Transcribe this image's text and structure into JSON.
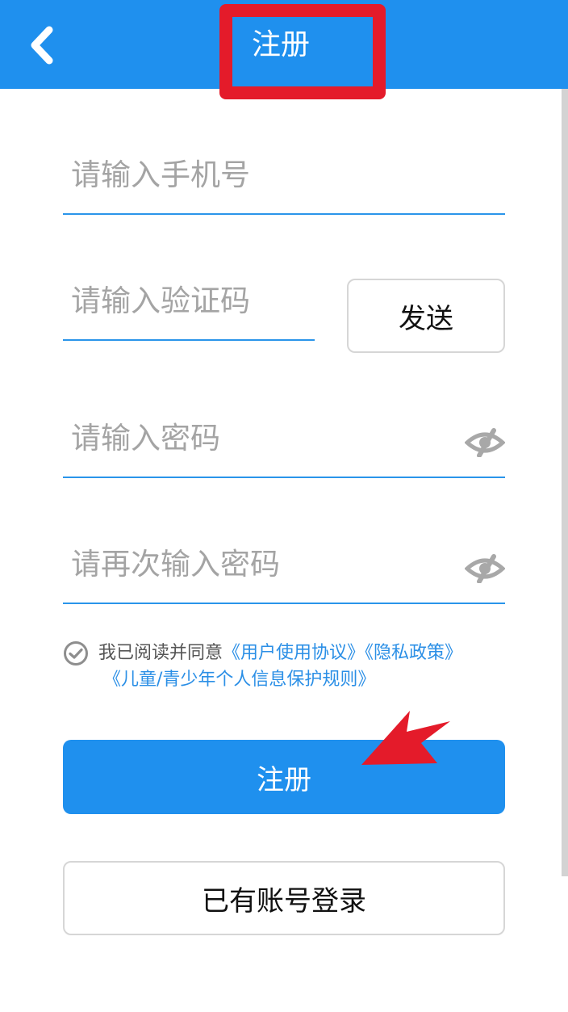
{
  "header": {
    "title": "注册",
    "back_icon": "chevron-left-icon"
  },
  "form": {
    "phone_placeholder": "请输入手机号",
    "code_placeholder": "请输入验证码",
    "send_label": "发送",
    "password_placeholder": "请输入密码",
    "password_confirm_placeholder": "请再次输入密码",
    "eye_icon": "eye-hidden-icon"
  },
  "agreement": {
    "text": "我已阅读并同意",
    "user_agreement": "《用户使用协议》",
    "privacy_policy": "《隐私政策》",
    "child_policy": "《儿童/青少年个人信息保护规则》"
  },
  "actions": {
    "register_label": "注册",
    "login_label": "已有账号登录"
  },
  "colors": {
    "primary": "#1f90ee",
    "link": "#2b8fe6",
    "annotation": "#e41b2a"
  }
}
